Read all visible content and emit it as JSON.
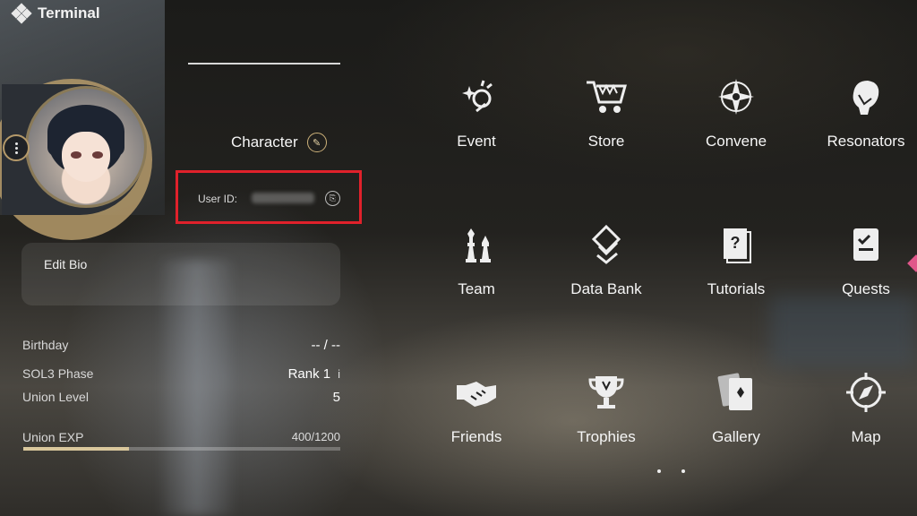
{
  "header": {
    "title": "Terminal",
    "icon": "terminal-diamond-icon"
  },
  "profile": {
    "character_label": "Character",
    "user_id_label": "User ID:",
    "edit_bio_label": "Edit Bio",
    "stats": {
      "birthday_label": "Birthday",
      "birthday_value": "-- / --",
      "sol3_label": "SOL3 Phase",
      "sol3_value": "Rank 1",
      "sol3_info": "i",
      "union_level_label": "Union Level",
      "union_level_value": "5",
      "union_exp_label": "Union EXP",
      "union_exp_value": "400/1200",
      "union_exp_progress": 0.3333
    }
  },
  "menu": {
    "items": [
      {
        "label": "Event",
        "icon": "event-sparkle-icon"
      },
      {
        "label": "Store",
        "icon": "store-cart-icon"
      },
      {
        "label": "Convene",
        "icon": "convene-star-icon"
      },
      {
        "label": "Resonators",
        "icon": "resonators-head-icon"
      },
      {
        "label": "Team",
        "icon": "team-chess-icon"
      },
      {
        "label": "Data Bank",
        "icon": "data-bank-icon"
      },
      {
        "label": "Tutorials",
        "icon": "tutorials-book-icon"
      },
      {
        "label": "Quests",
        "icon": "quests-checklist-icon"
      },
      {
        "label": "Friends",
        "icon": "friends-handshake-icon"
      },
      {
        "label": "Trophies",
        "icon": "trophies-cup-icon"
      },
      {
        "label": "Gallery",
        "icon": "gallery-cards-icon"
      },
      {
        "label": "Map",
        "icon": "map-compass-icon"
      }
    ]
  },
  "colors": {
    "accent_gold": "#d9c79c",
    "highlight_red": "#e0212b"
  }
}
